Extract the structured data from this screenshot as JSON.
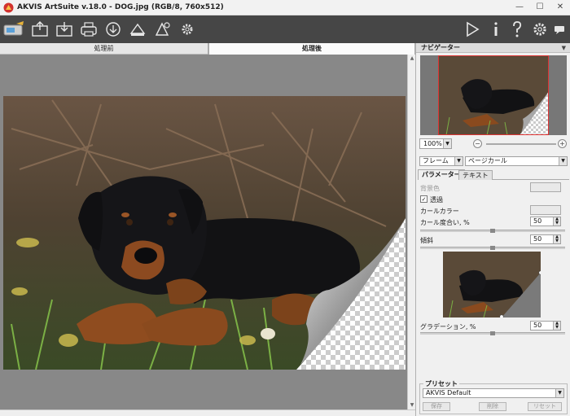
{
  "window": {
    "title": "AKVIS ArtSuite v.18.0 - DOG.jpg (RGB/8, 760x512)",
    "minimize": "—",
    "maximize": "☐",
    "close": "✕"
  },
  "toolbar": {
    "left_icons": [
      "home-icon",
      "open-icon",
      "save-icon",
      "print-icon",
      "share-icon",
      "batch-icon",
      "effects-icon",
      "settings-gear-icon"
    ],
    "right_icons": [
      "run-icon",
      "info-icon",
      "help-icon",
      "preferences-icon",
      "notifications-icon"
    ]
  },
  "view_tabs": {
    "before": "処理前",
    "after": "処理後"
  },
  "navigator": {
    "title": "ナビゲーター",
    "zoom": "100%",
    "zoom_out": "−",
    "zoom_in": "+"
  },
  "effect": {
    "category": "フレーム",
    "type": "ページカール"
  },
  "param_tabs": {
    "parameters": "パラメーター",
    "text": "テキスト"
  },
  "params": {
    "background_color_label": "背景色",
    "transparency_label": "透過",
    "transparency_checked": true,
    "curl_color_label": "カールカラー",
    "curl_degree_label": "カール度合い, %",
    "curl_degree_value": "50",
    "tilt_label": "傾斜",
    "tilt_value": "50",
    "gradation_label": "グラデーション, %",
    "gradation_value": "50"
  },
  "presets": {
    "title": "プリセット",
    "selected": "AKVIS Default",
    "save_label": "保存",
    "delete_label": "削除",
    "reset_label": "リセット"
  },
  "colors": {
    "toolbar_bg": "#464646",
    "canvas_bg": "#888888",
    "panel_bg": "#f0f0f0"
  }
}
